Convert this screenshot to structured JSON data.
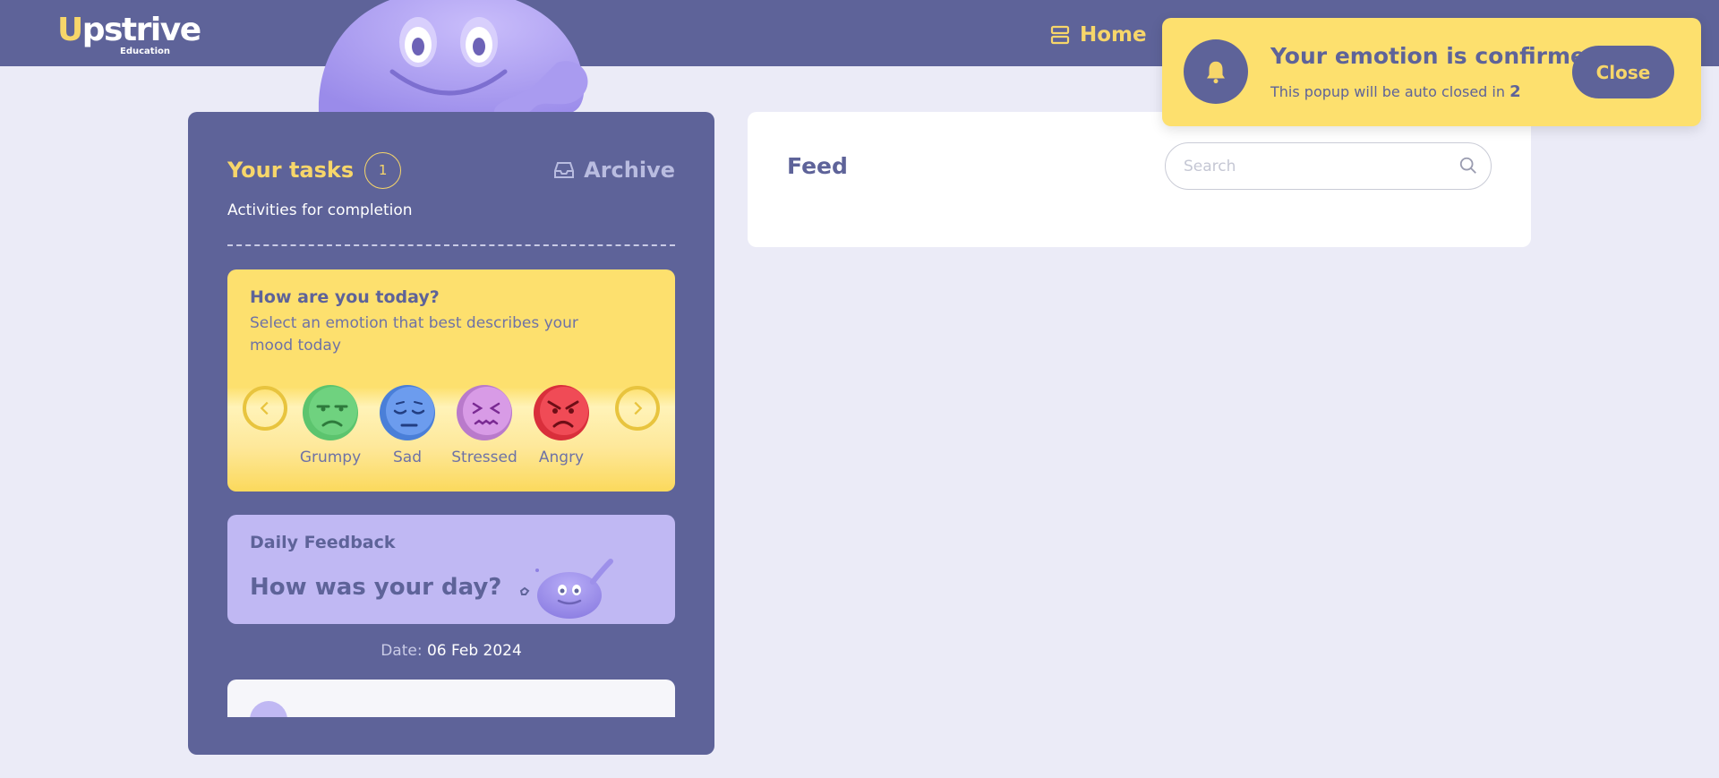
{
  "brand": {
    "name_first": "U",
    "name_rest": "pstrive",
    "tagline": "Education"
  },
  "nav": {
    "home_label": "Home"
  },
  "tasks": {
    "title": "Your tasks",
    "count": "1",
    "archive_label": "Archive",
    "subtitle": "Activities for completion"
  },
  "mood": {
    "title": "How are you today?",
    "description": "Select an emotion that best describes your mood today",
    "emotions": [
      {
        "label": "Grumpy",
        "color": "#5cc46e"
      },
      {
        "label": "Sad",
        "color": "#5b8fe6"
      },
      {
        "label": "Stressed",
        "color": "#c98ad8"
      },
      {
        "label": "Angry",
        "color": "#ec4651"
      }
    ]
  },
  "feedback": {
    "title": "Daily Feedback",
    "question": "How was your day?"
  },
  "date": {
    "label": "Date:",
    "value": "06 Feb 2024"
  },
  "feed": {
    "title": "Feed",
    "search_placeholder": "Search"
  },
  "toast": {
    "title": "Your emotion is confirmed",
    "message": "This popup will be auto closed in",
    "seconds": "2",
    "close_label": "Close"
  },
  "colors": {
    "primary": "#5e6399",
    "accent_yellow": "#f7d66a",
    "background": "#ebebf7",
    "lavender": "#c0b8f3"
  }
}
